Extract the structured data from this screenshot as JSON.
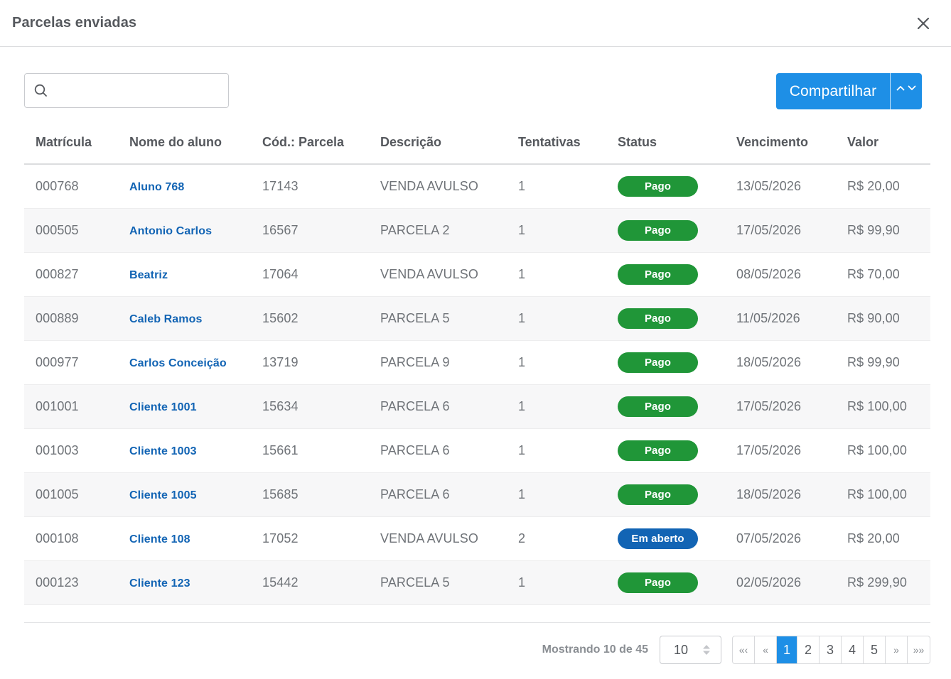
{
  "modal": {
    "title": "Parcelas enviadas"
  },
  "search": {
    "placeholder": "",
    "value": ""
  },
  "share": {
    "label": "Compartilhar"
  },
  "table": {
    "headers": [
      "Matrícula",
      "Nome do aluno",
      "Cód.: Parcela",
      "Descrição",
      "Tentativas",
      "Status",
      "Vencimento",
      "Valor"
    ],
    "rows": [
      {
        "matricula": "000768",
        "nome": "Aluno 768",
        "codigo": "17143",
        "descricao": "VENDA AVULSO",
        "tentativas": "1",
        "status": "Pago",
        "vencimento": "13/05/2026",
        "valor": "R$ 20,00"
      },
      {
        "matricula": "000505",
        "nome": "Antonio Carlos",
        "codigo": "16567",
        "descricao": "PARCELA 2",
        "tentativas": "1",
        "status": "Pago",
        "vencimento": "17/05/2026",
        "valor": "R$ 99,90"
      },
      {
        "matricula": "000827",
        "nome": "Beatriz",
        "codigo": "17064",
        "descricao": "VENDA AVULSO",
        "tentativas": "1",
        "status": "Pago",
        "vencimento": "08/05/2026",
        "valor": "R$ 70,00"
      },
      {
        "matricula": "000889",
        "nome": "Caleb Ramos",
        "codigo": "15602",
        "descricao": "PARCELA 5",
        "tentativas": "1",
        "status": "Pago",
        "vencimento": "11/05/2026",
        "valor": "R$ 90,00"
      },
      {
        "matricula": "000977",
        "nome": "Carlos Conceição",
        "codigo": "13719",
        "descricao": "PARCELA 9",
        "tentativas": "1",
        "status": "Pago",
        "vencimento": "18/05/2026",
        "valor": "R$ 99,90"
      },
      {
        "matricula": "001001",
        "nome": "Cliente 1001",
        "codigo": "15634",
        "descricao": "PARCELA 6",
        "tentativas": "1",
        "status": "Pago",
        "vencimento": "17/05/2026",
        "valor": "R$ 100,00"
      },
      {
        "matricula": "001003",
        "nome": "Cliente 1003",
        "codigo": "15661",
        "descricao": "PARCELA 6",
        "tentativas": "1",
        "status": "Pago",
        "vencimento": "17/05/2026",
        "valor": "R$ 100,00"
      },
      {
        "matricula": "001005",
        "nome": "Cliente 1005",
        "codigo": "15685",
        "descricao": "PARCELA 6",
        "tentativas": "1",
        "status": "Pago",
        "vencimento": "18/05/2026",
        "valor": "R$ 100,00"
      },
      {
        "matricula": "000108",
        "nome": "Cliente 108",
        "codigo": "17052",
        "descricao": "VENDA AVULSO",
        "tentativas": "2",
        "status": "Em aberto",
        "vencimento": "07/05/2026",
        "valor": "R$ 20,00"
      },
      {
        "matricula": "000123",
        "nome": "Cliente 123",
        "codigo": "15442",
        "descricao": "PARCELA 5",
        "tentativas": "1",
        "status": "Pago",
        "vencimento": "02/05/2026",
        "valor": "R$ 299,90"
      }
    ]
  },
  "status_colors": {
    "Pago": "#209638",
    "Em aberto": "#1264b4"
  },
  "pagination": {
    "showing": "Mostrando 10 de 45",
    "page_size": "10",
    "first": "«‹",
    "prev": "«",
    "pages": [
      "1",
      "2",
      "3",
      "4",
      "5"
    ],
    "current": "1",
    "next": "»",
    "last": "»»"
  },
  "icons": {
    "close": "close-icon",
    "search": "search-icon",
    "share_toggle": "chevron-up-down-icon"
  }
}
